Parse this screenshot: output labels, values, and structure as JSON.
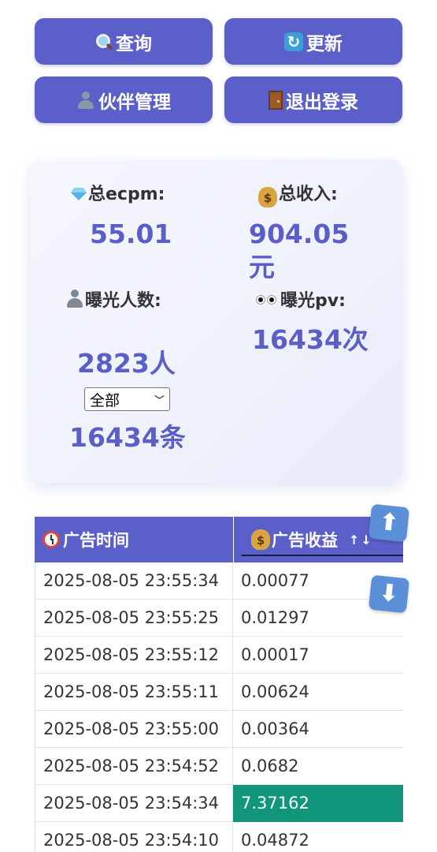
{
  "toolbar": {
    "query_label": "查询",
    "refresh_label": "更新",
    "partner_label": "伙伴管理",
    "logout_label": "退出登录"
  },
  "stats": {
    "ecpm_label": "总ecpm:",
    "ecpm_value": "55.01",
    "income_label": "总收入:",
    "income_value": "904.05元",
    "exposure_label": "曝光人数:",
    "exposure_value": "2823人",
    "pv_label": "曝光pv:",
    "pv_value": "16434次",
    "filter_selected": "全部",
    "count_value": "16434条",
    "accent_color": "#5a5fc7"
  },
  "table": {
    "col_time": "广告时间",
    "col_income": "广告收益",
    "sort_arrows": "↑↓",
    "rows": [
      {
        "time": "2025-08-05 23:55:34",
        "value": "0.00077"
      },
      {
        "time": "2025-08-05 23:55:25",
        "value": "0.01297"
      },
      {
        "time": "2025-08-05 23:55:12",
        "value": "0.00017"
      },
      {
        "time": "2025-08-05 23:55:11",
        "value": "0.00624"
      },
      {
        "time": "2025-08-05 23:55:00",
        "value": "0.00364"
      },
      {
        "time": "2025-08-05 23:54:52",
        "value": "0.0682"
      },
      {
        "time": "2025-08-05 23:54:34",
        "value": "7.37162",
        "highlight": true
      },
      {
        "time": "2025-08-05 23:54:10",
        "value": "0.04872"
      }
    ],
    "highlight_color": "#12967b"
  },
  "floating": {
    "scroll_top_glyph": "⬆",
    "scroll_bottom_glyph": "⬇"
  },
  "icons": {
    "query": "magnifier-icon",
    "refresh": "refresh-icon",
    "partner": "bust-icon",
    "logout": "door-icon",
    "ecpm": "gem-icon",
    "income": "money-bag-icon",
    "exposure": "person-icon",
    "pv": "eyes-icon",
    "time": "alarm-clock-icon"
  }
}
